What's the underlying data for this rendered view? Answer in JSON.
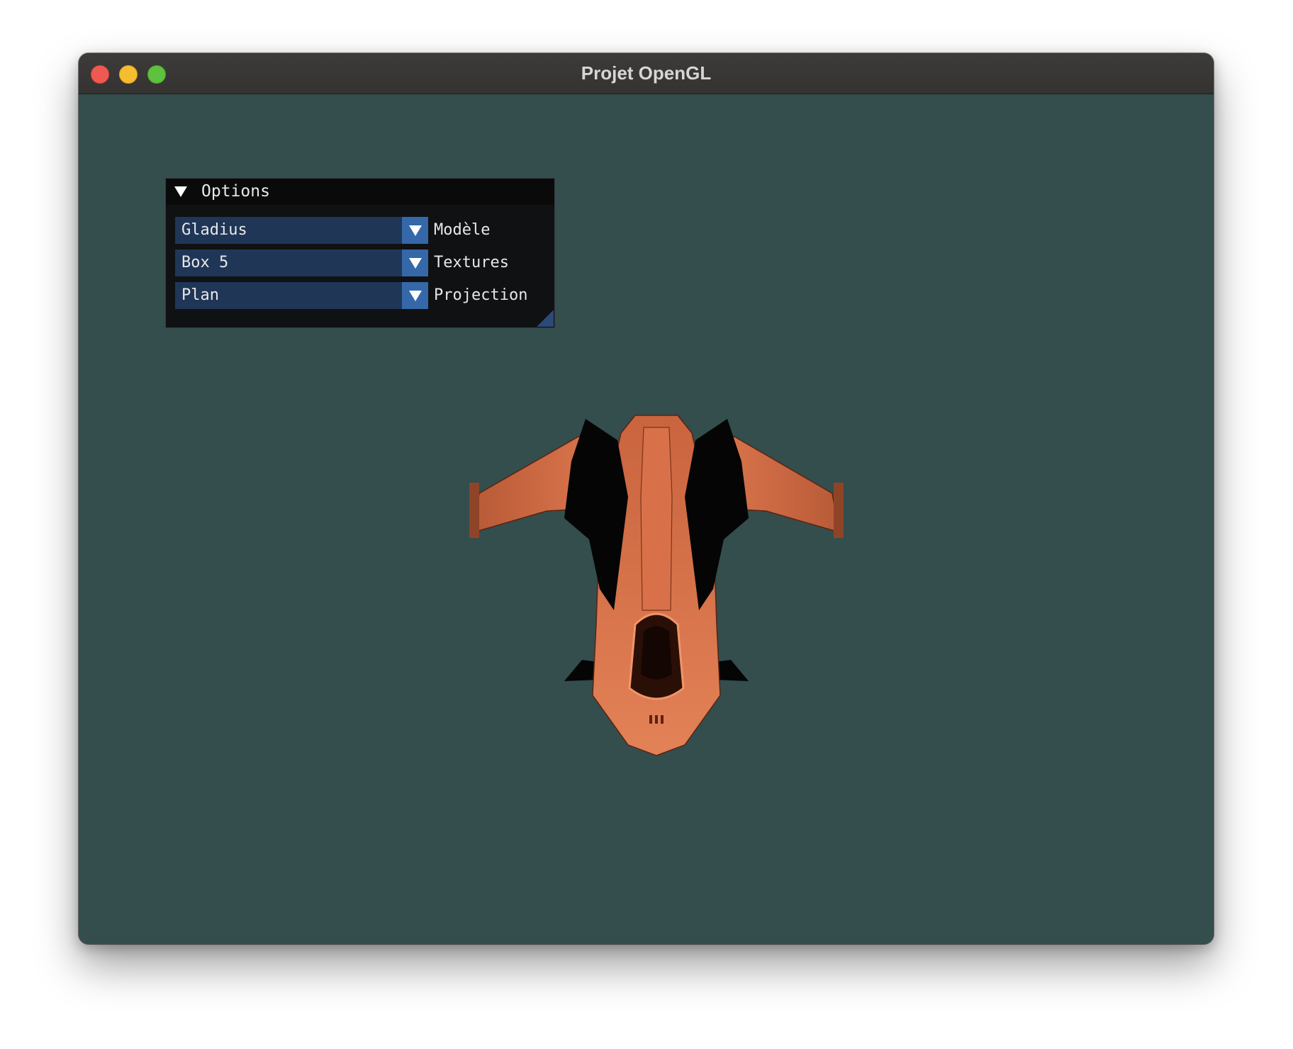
{
  "window": {
    "title": "Projet OpenGL"
  },
  "options_panel": {
    "title": "Options",
    "rows": [
      {
        "value": "Gladius",
        "label": "Modèle"
      },
      {
        "value": "Box 5",
        "label": "Textures"
      },
      {
        "value": "Plan",
        "label": "Projection"
      }
    ]
  },
  "colors": {
    "viewport_background": "#344d4d",
    "panel_background": "#101112",
    "combo_background": "#1f3657",
    "combo_button": "#3568a8",
    "ship_hull": "#d9724a"
  },
  "icons": {
    "collapse_arrow": "triangle-down",
    "combo_arrow": "triangle-down"
  }
}
